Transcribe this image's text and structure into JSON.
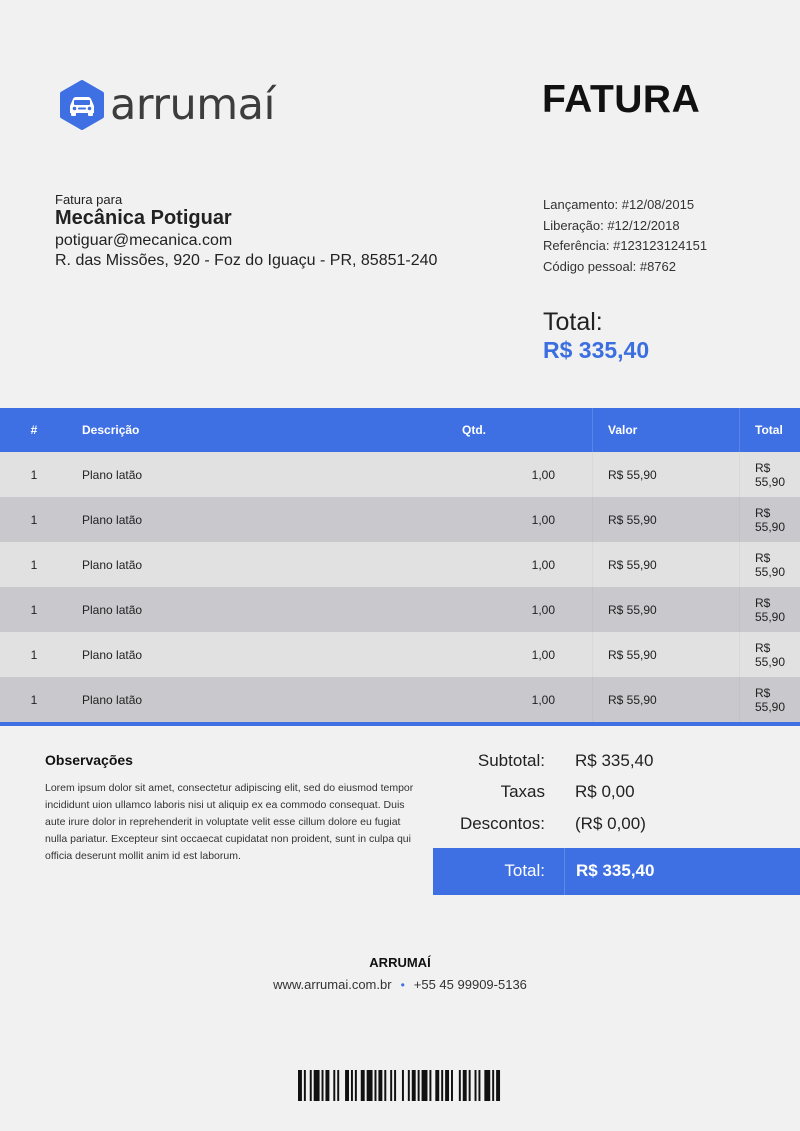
{
  "brand": {
    "name": "arrumaí",
    "accent": "#3e70e3"
  },
  "document": {
    "title": "FATURA"
  },
  "bill_to": {
    "label": "Fatura para",
    "name": "Mecânica Potiguar",
    "email": "potiguar@mecanica.com",
    "address": "R. das Missões, 920 - Foz do Iguaçu - PR, 85851-240"
  },
  "meta": {
    "launch": "Lançamento: #12/08/2015",
    "release": "Liberação: #12/12/2018",
    "reference": "Referência: #123123124151",
    "personal_code": "Código pessoal: #8762"
  },
  "total_top": {
    "label": "Total:",
    "value": "R$ 335,40"
  },
  "table": {
    "headers": [
      "#",
      "Descrição",
      "Qtd.",
      "Valor",
      "Total"
    ],
    "rows": [
      [
        "1",
        "Plano latão",
        "1,00",
        "R$ 55,90",
        "R$ 55,90"
      ],
      [
        "1",
        "Plano latão",
        "1,00",
        "R$ 55,90",
        "R$ 55,90"
      ],
      [
        "1",
        "Plano latão",
        "1,00",
        "R$ 55,90",
        "R$ 55,90"
      ],
      [
        "1",
        "Plano latão",
        "1,00",
        "R$ 55,90",
        "R$ 55,90"
      ],
      [
        "1",
        "Plano latão",
        "1,00",
        "R$ 55,90",
        "R$ 55,90"
      ],
      [
        "1",
        "Plano latão",
        "1,00",
        "R$ 55,90",
        "R$ 55,90"
      ]
    ]
  },
  "notes": {
    "title": "Observações",
    "body": "Lorem ipsum dolor sit amet, consectetur adipiscing elit, sed do eiusmod tempor incididunt uion ullamco laboris nisi ut aliquip ex ea commodo consequat. Duis aute irure dolor in reprehenderit in voluptate velit esse cillum dolore eu fugiat nulla pariatur. Excepteur sint occaecat cupidatat non proident, sunt in culpa qui officia deserunt mollit anim id est laborum."
  },
  "summary": {
    "subtotal_label": "Subtotal:",
    "subtotal_value": "R$ 335,40",
    "taxes_label": "Taxas",
    "taxes_value": "R$ 0,00",
    "discounts_label": "Descontos:",
    "discounts_value": "(R$ 0,00)",
    "total_label": "Total:",
    "total_value": "R$ 335,40"
  },
  "footer": {
    "company": "ARRUMAÍ",
    "website": "www.arrumai.com.br",
    "phone": "+55 45 99909-5136"
  }
}
